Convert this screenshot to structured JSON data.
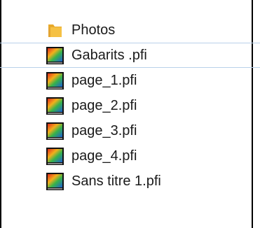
{
  "file_list": {
    "items": [
      {
        "label": "Photos",
        "icon": "folder-icon",
        "selected": false
      },
      {
        "label": "Gabarits .pfi",
        "icon": "pfi-file-icon",
        "selected": true
      },
      {
        "label": "page_1.pfi",
        "icon": "pfi-file-icon",
        "selected": false
      },
      {
        "label": "page_2.pfi",
        "icon": "pfi-file-icon",
        "selected": false
      },
      {
        "label": "page_3.pfi",
        "icon": "pfi-file-icon",
        "selected": false
      },
      {
        "label": "page_4.pfi",
        "icon": "pfi-file-icon",
        "selected": false
      },
      {
        "label": "Sans titre 1.pfi",
        "icon": "pfi-file-icon",
        "selected": false
      }
    ]
  },
  "colors": {
    "selection_border": "#b9d1ea",
    "folder": "#f5c144",
    "text": "#1a1a1a"
  }
}
